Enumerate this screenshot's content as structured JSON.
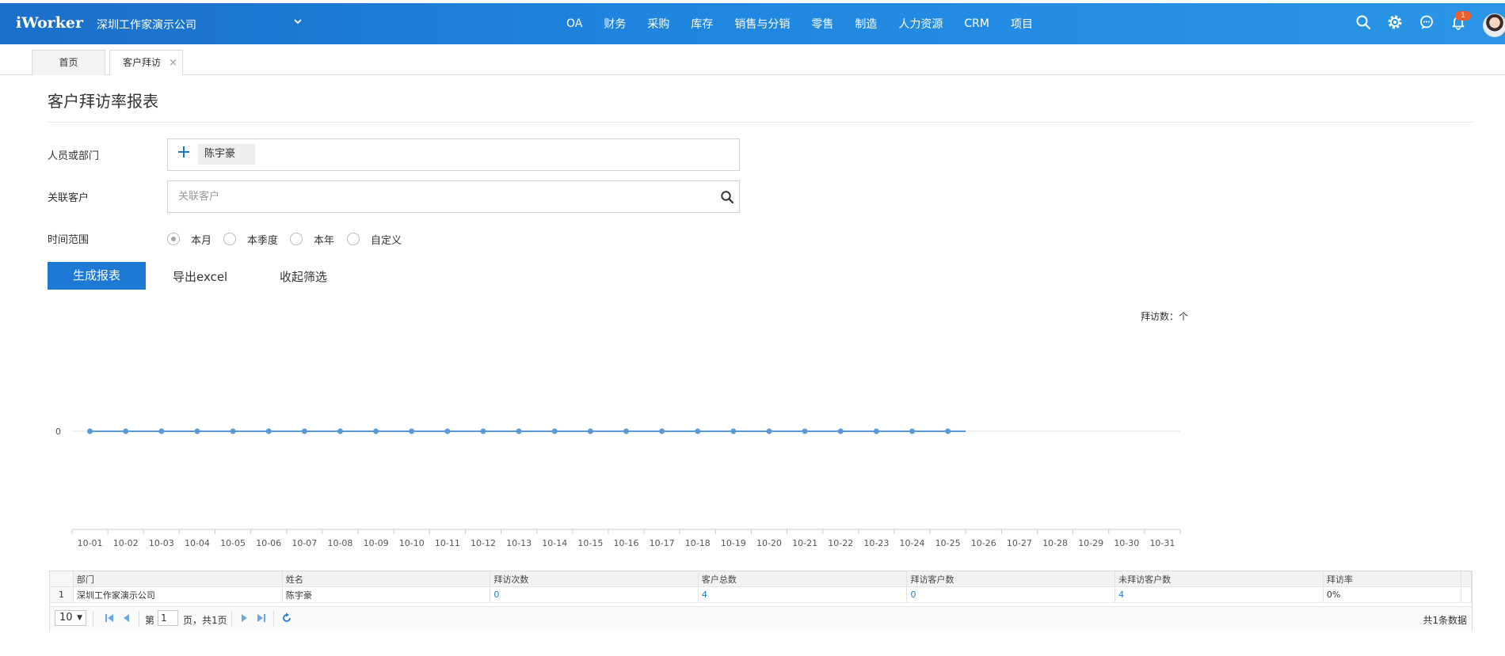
{
  "header": {
    "brand": "iWorker",
    "company": "深圳工作家演示公司",
    "nav": [
      "OA",
      "财务",
      "采购",
      "库存",
      "销售与分销",
      "零售",
      "制造",
      "人力资源",
      "CRM",
      "项目"
    ],
    "notification_count": "1",
    "icons": [
      "search-icon",
      "settings-icon",
      "chat-icon",
      "bell-icon",
      "avatar"
    ]
  },
  "tabs": [
    {
      "label": "首页"
    },
    {
      "label": "客户拜访",
      "close": "×"
    }
  ],
  "page": {
    "title": "客户拜访率报表"
  },
  "filters": {
    "person_label": "人员或部门",
    "person_tag": "陈宇豪",
    "customer_label": "关联客户",
    "customer_placeholder": "关联客户",
    "time_label": "时间范围",
    "time_options": [
      "本月",
      "本季度",
      "本年",
      "自定义"
    ],
    "time_selected": "本月"
  },
  "actions": {
    "generate": "生成报表",
    "export": "导出excel",
    "collapse": "收起筛选"
  },
  "chart_data": {
    "type": "line",
    "unit_label": "拜访数：个",
    "y_tick": "0",
    "x": [
      "10-01",
      "10-02",
      "10-03",
      "10-04",
      "10-05",
      "10-06",
      "10-07",
      "10-08",
      "10-09",
      "10-10",
      "10-11",
      "10-12",
      "10-13",
      "10-14",
      "10-15",
      "10-16",
      "10-17",
      "10-18",
      "10-19",
      "10-20",
      "10-21",
      "10-22",
      "10-23",
      "10-24",
      "10-25",
      "10-26",
      "10-27",
      "10-28",
      "10-29",
      "10-30",
      "10-31"
    ],
    "values": [
      0,
      0,
      0,
      0,
      0,
      0,
      0,
      0,
      0,
      0,
      0,
      0,
      0,
      0,
      0,
      0,
      0,
      0,
      0,
      0,
      0,
      0,
      0,
      0,
      0
    ],
    "accent": "#5b9bd5"
  },
  "table": {
    "columns": [
      "部门",
      "姓名",
      "拜访次数",
      "客户总数",
      "拜访客户数",
      "未拜访客户数",
      "拜访率"
    ],
    "rows": [
      {
        "num": "1",
        "dept": "深圳工作家演示公司",
        "name": "陈宇豪",
        "visits": "0",
        "customers": "4",
        "visited": "0",
        "unvisited": "4",
        "rate": "0%"
      }
    ]
  },
  "pager": {
    "page_size": "10",
    "prefix": "第",
    "page": "1",
    "suffix": "页，共1页",
    "total": "共1条数据"
  },
  "colors": {
    "header": "#1f86df",
    "primary_button": "#1e79d4",
    "link": "#1e79d4",
    "badge": "#ef5d2d"
  }
}
